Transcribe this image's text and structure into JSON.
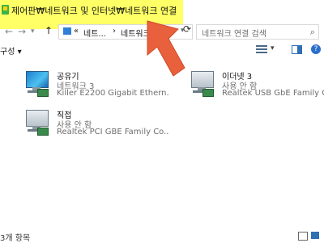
{
  "window": {
    "title": "제어판₩네트워크 및 인터넷₩네트워크 연결"
  },
  "address": {
    "crumb_prefix": "«",
    "crumb1": "네트...",
    "separator": "›",
    "crumb2": "네트워크",
    "search_placeholder": "네트워크 연결 검색"
  },
  "toolbar": {
    "organize_label": "구성 ▾"
  },
  "connections": [
    {
      "name": "공유기",
      "status": "네트워크  3",
      "device": "Killer E2200 Gigabit Ethern...",
      "icon": "network-adapter-connected-icon"
    },
    {
      "name": "이더넷 3",
      "status": "사용 안 함",
      "device": "Realtek USB GbE Family C...",
      "icon": "network-adapter-disabled-icon"
    },
    {
      "name": "직접",
      "status": "사용 안 함",
      "device": "Realtek PCI GBE Family Co...",
      "icon": "network-adapter-disabled-icon"
    }
  ],
  "statusbar": {
    "item_count": "3개 항목"
  },
  "colors": {
    "highlight": "#ffff66",
    "annotation_arrow": "#e8603c"
  }
}
